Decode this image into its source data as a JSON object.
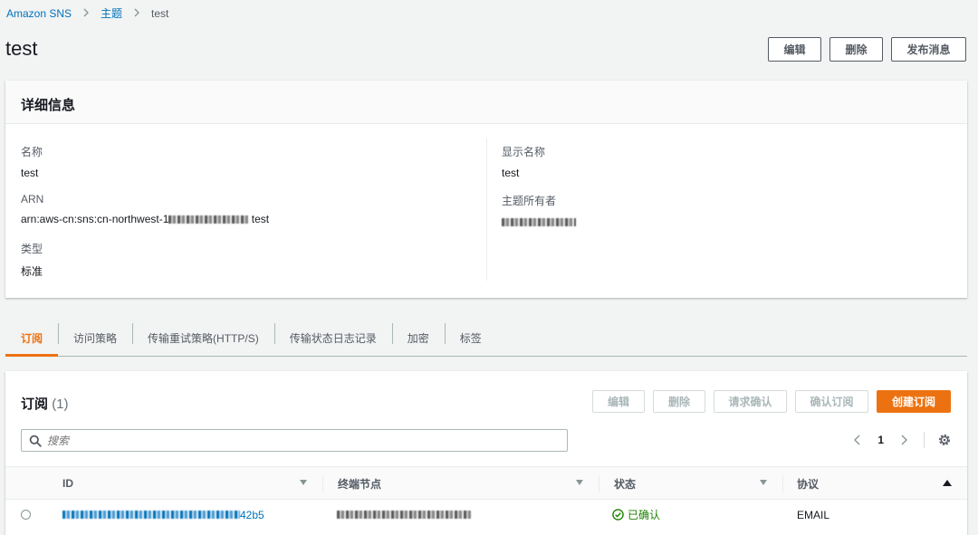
{
  "breadcrumb": {
    "root": "Amazon SNS",
    "section": "主题",
    "current": "test",
    "separator": ">"
  },
  "page": {
    "title": "test",
    "actions": {
      "edit": "编辑",
      "delete": "删除",
      "publish": "发布消息"
    }
  },
  "details": {
    "header": "详细信息",
    "name_label": "名称",
    "name_value": "test",
    "arn_label": "ARN",
    "arn_prefix": "arn:aws-cn:sns:cn-northwest-1",
    "arn_suffix": "test",
    "type_label": "类型",
    "type_value": "标准",
    "display_name_label": "显示名称",
    "display_name_value": "test",
    "owner_label": "主题所有者"
  },
  "tabs": [
    {
      "label": "订阅",
      "active": true
    },
    {
      "label": "访问策略",
      "active": false
    },
    {
      "label": "传输重试策略(HTTP/S)",
      "active": false
    },
    {
      "label": "传输状态日志记录",
      "active": false
    },
    {
      "label": "加密",
      "active": false
    },
    {
      "label": "标签",
      "active": false
    }
  ],
  "subscriptions": {
    "title": "订阅",
    "count": "(1)",
    "actions": {
      "edit": "编辑",
      "delete": "删除",
      "request_confirm": "请求确认",
      "confirm": "确认订阅",
      "create": "创建订阅"
    },
    "search_placeholder": "搜索",
    "page_number": "1",
    "columns": {
      "id": "ID",
      "endpoint": "终端节点",
      "status": "状态",
      "protocol": "协议"
    },
    "rows": [
      {
        "id_suffix": "42b5",
        "status": "已确认",
        "protocol": "EMAIL"
      }
    ]
  },
  "colors": {
    "accent": "#ec7211",
    "link": "#0073bb",
    "success": "#1d8102"
  }
}
